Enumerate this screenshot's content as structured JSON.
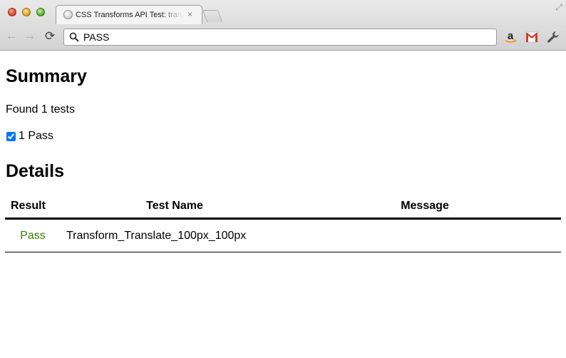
{
  "browser": {
    "tab_title": "CSS Transforms API Test: translate",
    "tab_close": "×",
    "address": "PASS",
    "back": "←",
    "forward": "→",
    "reload": "⟳",
    "resize_glyph": "⤢",
    "icons": {
      "search": "magnifier-icon",
      "amazon": "amazon-extension-icon",
      "gmail": "gmail-extension-icon",
      "wrench": "wrench-icon"
    }
  },
  "page": {
    "summary_heading": "Summary",
    "found_text": "Found 1 tests",
    "pass_summary": "1 Pass",
    "details_heading": "Details",
    "table": {
      "headers": [
        "Result",
        "Test Name",
        "Message"
      ],
      "rows": [
        {
          "result": "Pass",
          "name": "Transform_Translate_100px_100px",
          "message": ""
        }
      ]
    },
    "colors": {
      "pass": "#3d7d00"
    }
  }
}
